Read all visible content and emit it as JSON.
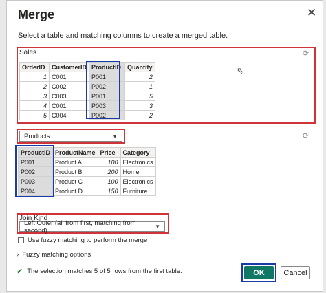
{
  "dialog": {
    "title": "Merge",
    "subtitle": "Select a table and matching columns to create a merged table."
  },
  "first_table": {
    "label": "Sales",
    "columns": [
      "OrderID",
      "CustomerID",
      "ProductID",
      "Quantity"
    ],
    "rows": [
      [
        "1",
        "C001",
        "P001",
        "2"
      ],
      [
        "2",
        "C002",
        "P002",
        "1"
      ],
      [
        "3",
        "C003",
        "P001",
        "5"
      ],
      [
        "4",
        "C001",
        "P003",
        "3"
      ],
      [
        "5",
        "C004",
        "P002",
        "2"
      ]
    ]
  },
  "second_table": {
    "selected": "Products",
    "columns": [
      "ProductID",
      "ProductName",
      "Price",
      "Category"
    ],
    "rows": [
      [
        "P001",
        "Product A",
        "100",
        "Electronics"
      ],
      [
        "P002",
        "Product B",
        "200",
        "Home"
      ],
      [
        "P003",
        "Product C",
        "100",
        "Electronics"
      ],
      [
        "P004",
        "Product D",
        "150",
        "Furniture"
      ]
    ]
  },
  "join": {
    "label": "Join Kind",
    "selected": "Left Outer (all from first, matching from second)"
  },
  "fuzzy": {
    "checkbox_label": "Use fuzzy matching to perform the merge",
    "options_label": "Fuzzy matching options"
  },
  "status": {
    "message": "The selection matches 5 of 5 rows from the first table."
  },
  "buttons": {
    "ok": "OK",
    "cancel": "Cancel"
  },
  "colors": {
    "highlight_red": "#d13438",
    "highlight_blue": "#1a3aa8",
    "ok_button": "#117865",
    "check": "#107c10"
  },
  "icons": [
    "close-icon",
    "refresh-icon",
    "chevron-down-icon",
    "chevron-right-icon",
    "checkmark-icon",
    "cursor-icon"
  ]
}
